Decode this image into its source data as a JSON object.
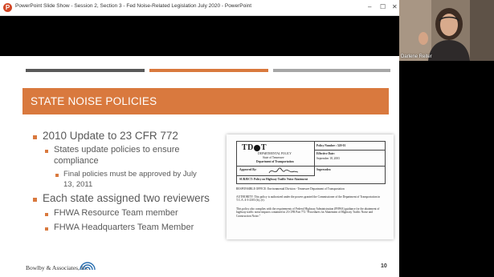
{
  "window": {
    "title": "PowerPoint Slide Show - Session 2, Section 3 - Fed Noise-Related Legislation July 2020 - PowerPoint",
    "app_icon": "powerpoint-icon",
    "controls": {
      "minimize": "–",
      "maximize": "☐",
      "close": "✕"
    }
  },
  "slide": {
    "title": "STATE NOISE POLICIES",
    "accent_color": "#d9793e",
    "bullets": [
      {
        "level": 1,
        "text": "2010 Update to 23 CFR 772"
      },
      {
        "level": 2,
        "text": "States update policies to ensure"
      },
      {
        "level": 2,
        "text": "compliance"
      },
      {
        "level": 3,
        "text": "Final policies must be approved by July"
      },
      {
        "level": 3,
        "text": "13, 2011"
      },
      {
        "level": 1,
        "text": "Each state assigned two reviewers"
      },
      {
        "level": 2,
        "text": "FHWA Resource Team member"
      },
      {
        "level": 2,
        "text": "FHWA Headquarters Team Member"
      }
    ],
    "document_image": {
      "logo": "TD",
      "logo_end": "T",
      "lines": [
        "DEPARTMENTAL POLICY",
        "State of Tennessee",
        "Department of Transportation"
      ],
      "policy_number": "Policy Number : 520-01",
      "effective_date_label": "Effective Date:",
      "effective_date": "September 18, 2003",
      "supersedes": "Supersedes:",
      "approved_by": "Approved By:",
      "subject": "SUBJECT: Policy on Highway Traffic Noise Abatement",
      "responsible_office": "RESPONSIBLE OFFICE: Environmental Division - Tennessee Department of Transportation",
      "authority": "AUTHORITY: This policy is authorized under the powers granted the Commissioner of the Department of Transportation in T.C.A. 4-3-2303 (b), (e).",
      "body": "This policy also complies with the requirements of Federal Highway Administration (FHWA) guidance for the abatement of highway traffic noise impacts contained in 23 CFR Part 772 \"Procedures for Abatement of Highway Traffic Noise and Construction Noise.\""
    },
    "footer": "Bowlby & Associates, Inc.",
    "page_number": "10"
  },
  "video": {
    "participant_name": "Darlene Reiter"
  }
}
